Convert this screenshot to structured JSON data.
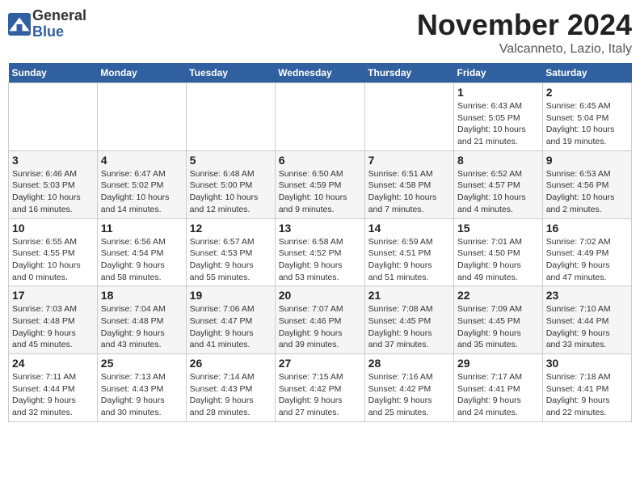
{
  "header": {
    "logo_line1": "General",
    "logo_line2": "Blue",
    "month": "November 2024",
    "location": "Valcanneto, Lazio, Italy"
  },
  "days_of_week": [
    "Sunday",
    "Monday",
    "Tuesday",
    "Wednesday",
    "Thursday",
    "Friday",
    "Saturday"
  ],
  "weeks": [
    [
      {
        "day": "",
        "info": ""
      },
      {
        "day": "",
        "info": ""
      },
      {
        "day": "",
        "info": ""
      },
      {
        "day": "",
        "info": ""
      },
      {
        "day": "",
        "info": ""
      },
      {
        "day": "1",
        "info": "Sunrise: 6:43 AM\nSunset: 5:05 PM\nDaylight: 10 hours\nand 21 minutes."
      },
      {
        "day": "2",
        "info": "Sunrise: 6:45 AM\nSunset: 5:04 PM\nDaylight: 10 hours\nand 19 minutes."
      }
    ],
    [
      {
        "day": "3",
        "info": "Sunrise: 6:46 AM\nSunset: 5:03 PM\nDaylight: 10 hours\nand 16 minutes."
      },
      {
        "day": "4",
        "info": "Sunrise: 6:47 AM\nSunset: 5:02 PM\nDaylight: 10 hours\nand 14 minutes."
      },
      {
        "day": "5",
        "info": "Sunrise: 6:48 AM\nSunset: 5:00 PM\nDaylight: 10 hours\nand 12 minutes."
      },
      {
        "day": "6",
        "info": "Sunrise: 6:50 AM\nSunset: 4:59 PM\nDaylight: 10 hours\nand 9 minutes."
      },
      {
        "day": "7",
        "info": "Sunrise: 6:51 AM\nSunset: 4:58 PM\nDaylight: 10 hours\nand 7 minutes."
      },
      {
        "day": "8",
        "info": "Sunrise: 6:52 AM\nSunset: 4:57 PM\nDaylight: 10 hours\nand 4 minutes."
      },
      {
        "day": "9",
        "info": "Sunrise: 6:53 AM\nSunset: 4:56 PM\nDaylight: 10 hours\nand 2 minutes."
      }
    ],
    [
      {
        "day": "10",
        "info": "Sunrise: 6:55 AM\nSunset: 4:55 PM\nDaylight: 10 hours\nand 0 minutes."
      },
      {
        "day": "11",
        "info": "Sunrise: 6:56 AM\nSunset: 4:54 PM\nDaylight: 9 hours\nand 58 minutes."
      },
      {
        "day": "12",
        "info": "Sunrise: 6:57 AM\nSunset: 4:53 PM\nDaylight: 9 hours\nand 55 minutes."
      },
      {
        "day": "13",
        "info": "Sunrise: 6:58 AM\nSunset: 4:52 PM\nDaylight: 9 hours\nand 53 minutes."
      },
      {
        "day": "14",
        "info": "Sunrise: 6:59 AM\nSunset: 4:51 PM\nDaylight: 9 hours\nand 51 minutes."
      },
      {
        "day": "15",
        "info": "Sunrise: 7:01 AM\nSunset: 4:50 PM\nDaylight: 9 hours\nand 49 minutes."
      },
      {
        "day": "16",
        "info": "Sunrise: 7:02 AM\nSunset: 4:49 PM\nDaylight: 9 hours\nand 47 minutes."
      }
    ],
    [
      {
        "day": "17",
        "info": "Sunrise: 7:03 AM\nSunset: 4:48 PM\nDaylight: 9 hours\nand 45 minutes."
      },
      {
        "day": "18",
        "info": "Sunrise: 7:04 AM\nSunset: 4:48 PM\nDaylight: 9 hours\nand 43 minutes."
      },
      {
        "day": "19",
        "info": "Sunrise: 7:06 AM\nSunset: 4:47 PM\nDaylight: 9 hours\nand 41 minutes."
      },
      {
        "day": "20",
        "info": "Sunrise: 7:07 AM\nSunset: 4:46 PM\nDaylight: 9 hours\nand 39 minutes."
      },
      {
        "day": "21",
        "info": "Sunrise: 7:08 AM\nSunset: 4:45 PM\nDaylight: 9 hours\nand 37 minutes."
      },
      {
        "day": "22",
        "info": "Sunrise: 7:09 AM\nSunset: 4:45 PM\nDaylight: 9 hours\nand 35 minutes."
      },
      {
        "day": "23",
        "info": "Sunrise: 7:10 AM\nSunset: 4:44 PM\nDaylight: 9 hours\nand 33 minutes."
      }
    ],
    [
      {
        "day": "24",
        "info": "Sunrise: 7:11 AM\nSunset: 4:44 PM\nDaylight: 9 hours\nand 32 minutes."
      },
      {
        "day": "25",
        "info": "Sunrise: 7:13 AM\nSunset: 4:43 PM\nDaylight: 9 hours\nand 30 minutes."
      },
      {
        "day": "26",
        "info": "Sunrise: 7:14 AM\nSunset: 4:43 PM\nDaylight: 9 hours\nand 28 minutes."
      },
      {
        "day": "27",
        "info": "Sunrise: 7:15 AM\nSunset: 4:42 PM\nDaylight: 9 hours\nand 27 minutes."
      },
      {
        "day": "28",
        "info": "Sunrise: 7:16 AM\nSunset: 4:42 PM\nDaylight: 9 hours\nand 25 minutes."
      },
      {
        "day": "29",
        "info": "Sunrise: 7:17 AM\nSunset: 4:41 PM\nDaylight: 9 hours\nand 24 minutes."
      },
      {
        "day": "30",
        "info": "Sunrise: 7:18 AM\nSunset: 4:41 PM\nDaylight: 9 hours\nand 22 minutes."
      }
    ]
  ]
}
